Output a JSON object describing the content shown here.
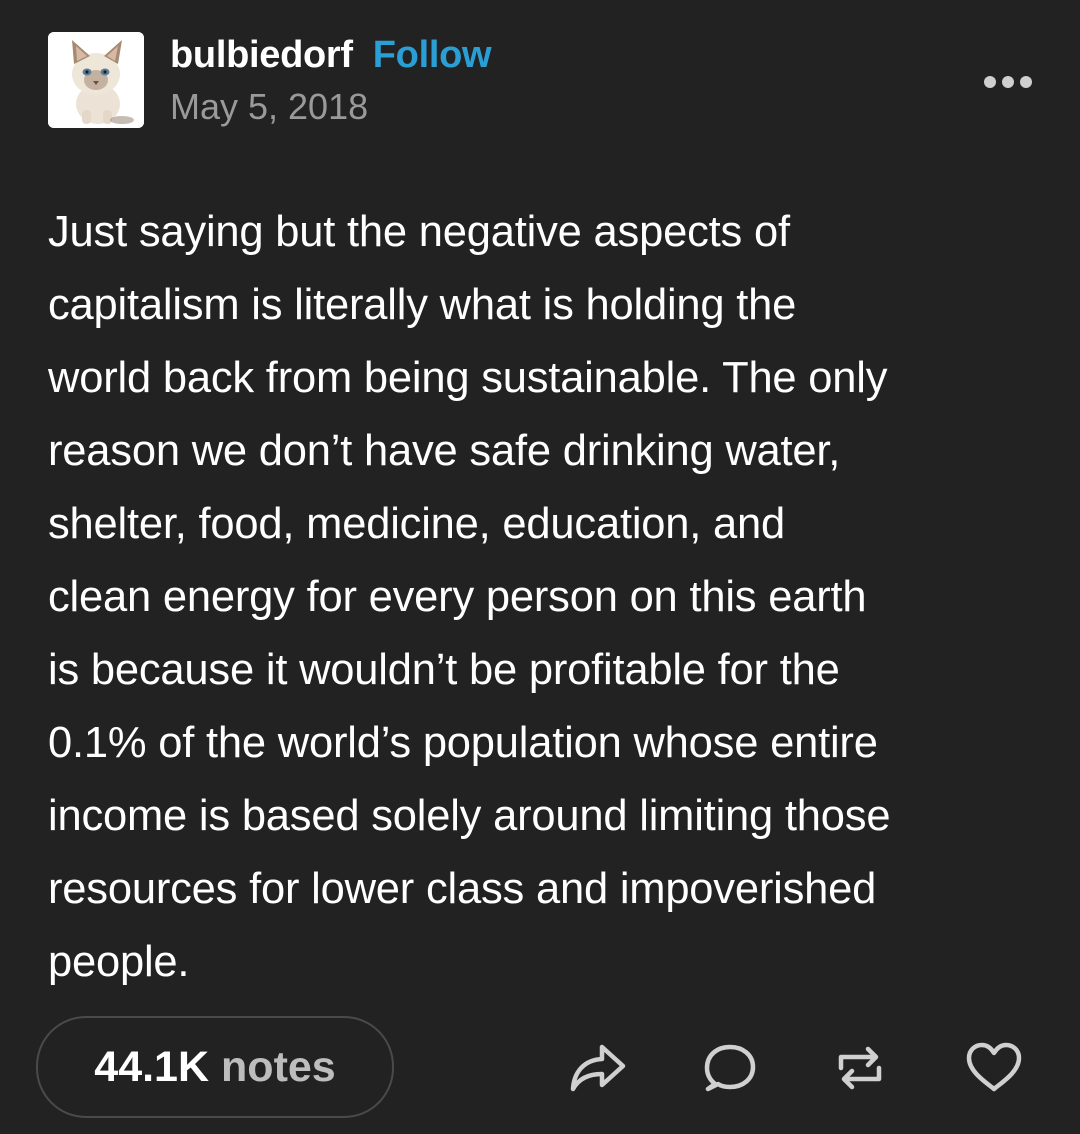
{
  "post": {
    "username": "bulbiedorf",
    "follow_label": "Follow",
    "date": "May 5, 2018",
    "avatar_description": "kitten",
    "body_lines": [
      "Just saying but the negative aspects of",
      "capitalism is literally what is holding the",
      "world back from being sustainable. The only",
      "reason we don’t have safe drinking water,",
      "shelter, food, medicine, education, and",
      "clean energy for every person on this earth",
      "is because it wouldn’t be profitable for the",
      "0.1% of the world’s population whose entire",
      "income is based solely around limiting those",
      "resources for lower class and impoverished",
      "people."
    ]
  },
  "footer": {
    "notes_count": "44.1K",
    "notes_label": "notes",
    "actions": [
      {
        "icon": "share-icon"
      },
      {
        "icon": "comment-icon"
      },
      {
        "icon": "reblog-icon"
      },
      {
        "icon": "heart-icon"
      }
    ]
  },
  "colors": {
    "background": "#222222",
    "follow": "#2a9fd6",
    "date": "#9a9a9a",
    "notes_label": "#bdbdbd"
  }
}
